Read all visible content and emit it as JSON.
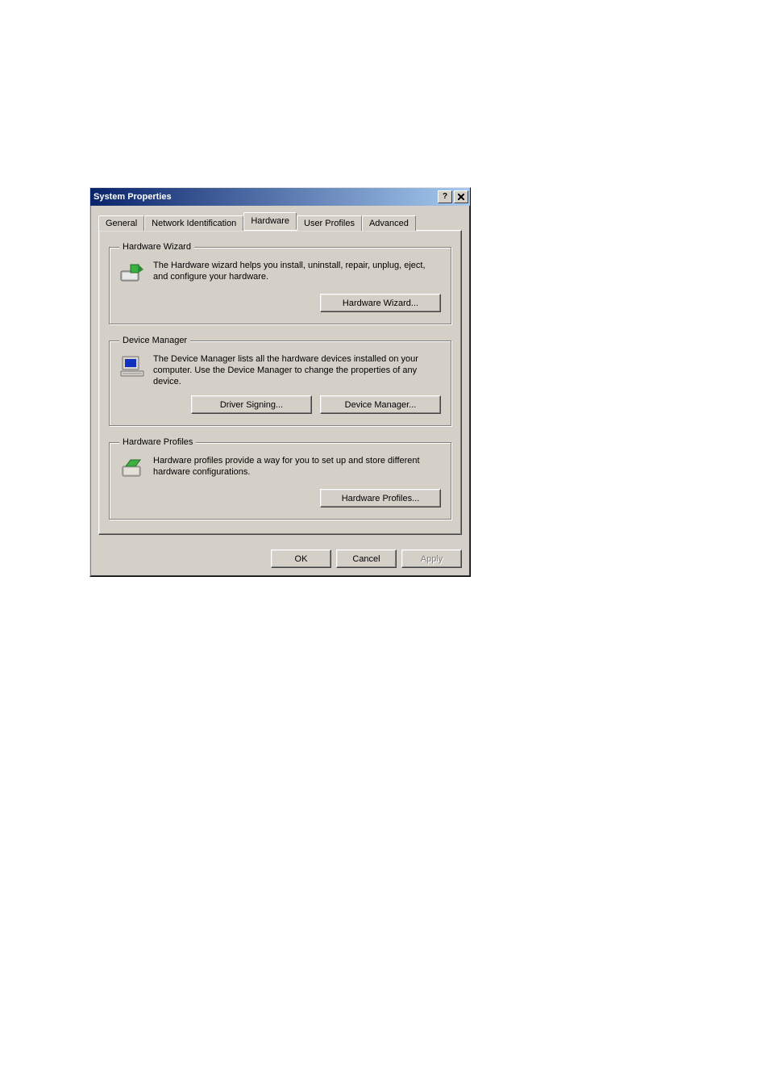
{
  "title": "System Properties",
  "tabs": {
    "general": "General",
    "netid": "Network Identification",
    "hardware": "Hardware",
    "profiles": "User Profiles",
    "advanced": "Advanced"
  },
  "activeTab": "hardware",
  "groups": {
    "hwwizard": {
      "legend": "Hardware Wizard",
      "text": "The Hardware wizard helps you install, uninstall, repair, unplug, eject, and configure your hardware.",
      "button": "Hardware Wizard..."
    },
    "devmgr": {
      "legend": "Device Manager",
      "text": "The Device Manager lists all the hardware devices installed on your computer. Use the Device Manager to change the properties of any device.",
      "button_sign": "Driver Signing...",
      "button_devmgr": "Device Manager..."
    },
    "hwprof": {
      "legend": "Hardware Profiles",
      "text": "Hardware profiles provide a way for you to set up and store different hardware configurations.",
      "button": "Hardware Profiles..."
    }
  },
  "dialogButtons": {
    "ok": "OK",
    "cancel": "Cancel",
    "apply": "Apply"
  }
}
